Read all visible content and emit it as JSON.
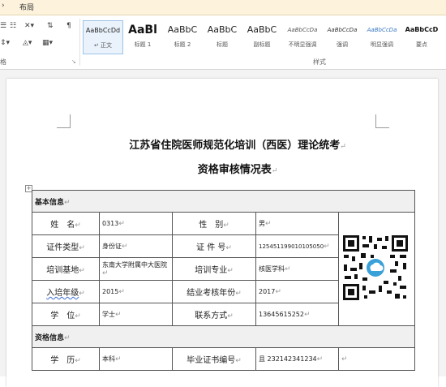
{
  "tabs": [
    {
      "label": "布局"
    }
  ],
  "ribbon": {
    "font_group_label": "格",
    "style_group_label": "样式",
    "styles": [
      {
        "sample": "AaBbCcDd",
        "name": "正文",
        "selected": true
      },
      {
        "sample": "AaBl",
        "name": "标题 1"
      },
      {
        "sample": "AaBbC",
        "name": "标题 2"
      },
      {
        "sample": "AaBbC",
        "name": "标题"
      },
      {
        "sample": "AaBbC",
        "name": "副标题"
      },
      {
        "sample": "AaBbCcDa",
        "name": "不明显强调"
      },
      {
        "sample": "AaBbCcDa",
        "name": "强调"
      },
      {
        "sample": "AaBbCcDa",
        "name": "明显强调"
      },
      {
        "sample": "AaBbCcD",
        "name": "要点"
      }
    ]
  },
  "document": {
    "title_line1": "江苏省住院医师规范化培训（西医）理论统考",
    "title_line2": "资格审核情况表",
    "sections": {
      "basic": "基本信息",
      "qualification": "资格信息"
    },
    "rows": [
      {
        "l1": "姓　名",
        "v1": "0313",
        "l2": "性　别",
        "v2": "男"
      },
      {
        "l1": "证件类型",
        "v1": "身份证",
        "l2": "证 件 号",
        "v2": "125451199010105050"
      },
      {
        "l1": "培训基地",
        "v1": "东南大学附属中大医院",
        "l2": "培训专业",
        "v2": "核医学科"
      },
      {
        "l1": "入培年级",
        "v1": "2015",
        "l2": "结业考核年份",
        "v2": "2017"
      },
      {
        "l1": "学　位",
        "v1": "学士",
        "l2": "联系方式",
        "v2": "13645615252"
      }
    ],
    "qual_row": {
      "l1": "学　历",
      "v1": "本科",
      "l2": "毕业证书编号",
      "v2": "且 232142341234"
    },
    "paragraph_mark": "↵"
  }
}
